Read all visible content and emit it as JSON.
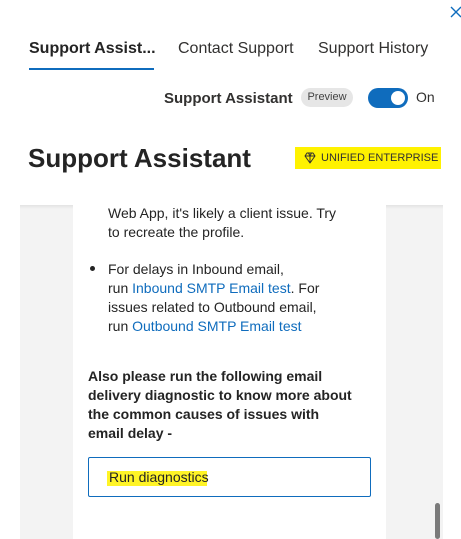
{
  "header": {
    "close_icon": "close-icon"
  },
  "tabs": [
    {
      "label": "Support Assist...",
      "active": true
    },
    {
      "label": "Contact Support",
      "active": false
    },
    {
      "label": "Support History",
      "active": false
    }
  ],
  "assistant_toggle": {
    "label": "Support Assistant",
    "badge": "Preview",
    "state_label": "On",
    "enabled": true
  },
  "page": {
    "title": "Support Assistant",
    "plan_badge": "UNIFIED ENTERPRISE",
    "plan_badge_icon": "diamond-icon"
  },
  "content": {
    "intro_line1": "Web App, it's likely a client issue. Try",
    "intro_line2": "to recreate the profile.",
    "bullet_line1": "For delays in Inbound email,",
    "bullet_run1": "run ",
    "bullet_link1": "Inbound SMTP Email test",
    "bullet_after1": ". For",
    "bullet_line3": "issues related to Outbound email,",
    "bullet_run2": "run ",
    "bullet_link2": "Outbound SMTP Email test",
    "diagnostic_prompt": "Also please run the following email delivery diagnostic to know more about the common causes of issues with email delay -",
    "diagnostics_button": "Run diagnostics"
  },
  "colors": {
    "accent": "#0f6cbd",
    "highlight": "#fff200",
    "panel_bg": "#f3f3f3"
  }
}
